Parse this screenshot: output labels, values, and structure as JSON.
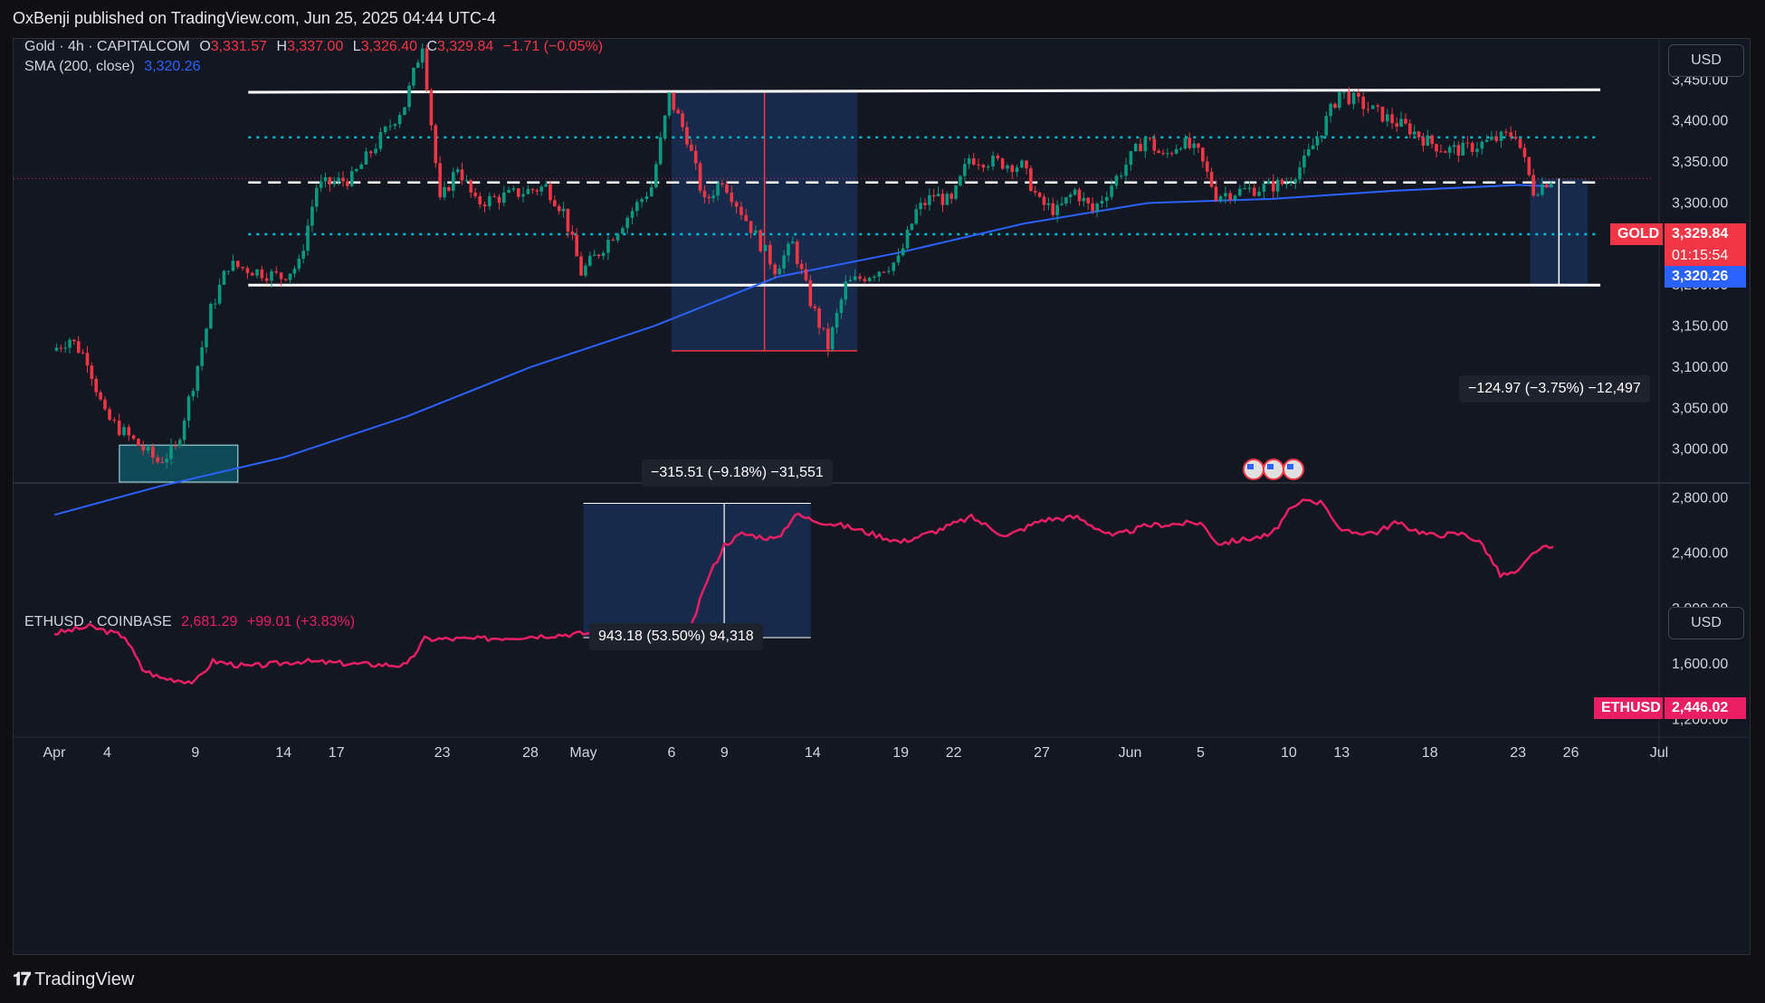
{
  "publisher": "OxBenji published on TradingView.com, Jun 25, 2025 04:44 UTC-4",
  "footer": {
    "brand": "TradingView"
  },
  "colors": {
    "up": "#089981",
    "down": "#f23645",
    "sma": "#2962ff",
    "eth": "#e91e63",
    "cyan": "#00bcd4",
    "box": "#1e3a6e"
  },
  "top_panel": {
    "legend": {
      "symbol": "Gold · 4h · CAPITALCOM",
      "o_label": "O",
      "o": "3,331.57",
      "h_label": "H",
      "h": "3,337.00",
      "l_label": "L",
      "l": "3,326.40",
      "c_label": "C",
      "c": "3,329.84",
      "change": "−1.71 (−0.05%)",
      "sma_label": "SMA (200, close)",
      "sma_value": "3,320.26"
    },
    "currency": "USD",
    "price_tag": {
      "name": "GOLD",
      "price": "3,329.84",
      "countdown": "01:15:54",
      "sma": "3,320.26"
    },
    "measure_1": "−315.51 (−9.18%) −31,551",
    "measure_2": "−124.97 (−3.75%) −12,497"
  },
  "bottom_panel": {
    "legend": {
      "symbol": "ETHUSD · COINBASE",
      "price": "2,681.29",
      "change": "+99.01 (+3.83%)"
    },
    "currency": "USD",
    "price_tag": {
      "name": "ETHUSD",
      "price": "2,446.02"
    },
    "measure": "943.18 (53.50%) 94,318"
  },
  "chart_data": [
    {
      "type": "candlestick",
      "symbol": "Gold",
      "timeframe": "4h",
      "y_ticks": [
        "3,000.00",
        "3,050.00",
        "3,100.00",
        "3,150.00",
        "3,200.00",
        "3,250.00",
        "3,300.00",
        "3,350.00",
        "3,400.00",
        "3,450.00"
      ],
      "ylim": [
        2960,
        3500
      ],
      "x_ticks": [
        "Apr",
        "4",
        "9",
        "14",
        "17",
        "23",
        "28",
        "May",
        "6",
        "9",
        "14",
        "19",
        "22",
        "27",
        "Jun",
        "5",
        "10",
        "13",
        "18",
        "23",
        "26",
        "Jul"
      ],
      "x_tick_dates": [
        "2025-04-01",
        "2025-04-04",
        "2025-04-09",
        "2025-04-14",
        "2025-04-17",
        "2025-04-23",
        "2025-04-28",
        "2025-05-01",
        "2025-05-06",
        "2025-05-09",
        "2025-05-14",
        "2025-05-19",
        "2025-05-22",
        "2025-05-27",
        "2025-06-01",
        "2025-06-05",
        "2025-06-10",
        "2025-06-13",
        "2025-06-18",
        "2025-06-23",
        "2025-06-26",
        "2025-07-01"
      ],
      "close_path": [
        [
          "2025-04-01",
          3120
        ],
        [
          "2025-04-02",
          3135
        ],
        [
          "2025-04-03",
          3110
        ],
        [
          "2025-04-04",
          3040
        ],
        [
          "2025-04-07",
          2985
        ],
        [
          "2025-04-08",
          3000
        ],
        [
          "2025-04-09",
          3080
        ],
        [
          "2025-04-10",
          3170
        ],
        [
          "2025-04-11",
          3225
        ],
        [
          "2025-04-14",
          3210
        ],
        [
          "2025-04-15",
          3225
        ],
        [
          "2025-04-16",
          3320
        ],
        [
          "2025-04-17",
          3325
        ],
        [
          "2025-04-18",
          3330
        ],
        [
          "2025-04-21",
          3420
        ],
        [
          "2025-04-22",
          3495
        ],
        [
          "2025-04-23",
          3300
        ],
        [
          "2025-04-24",
          3345
        ],
        [
          "2025-04-25",
          3300
        ],
        [
          "2025-04-28",
          3315
        ],
        [
          "2025-04-29",
          3320
        ],
        [
          "2025-04-30",
          3290
        ],
        [
          "2025-05-01",
          3215
        ],
        [
          "2025-05-02",
          3240
        ],
        [
          "2025-05-05",
          3320
        ],
        [
          "2025-05-06",
          3430
        ],
        [
          "2025-05-07",
          3380
        ],
        [
          "2025-05-08",
          3300
        ],
        [
          "2025-05-09",
          3330
        ],
        [
          "2025-05-12",
          3220
        ],
        [
          "2025-05-13",
          3250
        ],
        [
          "2025-05-14",
          3180
        ],
        [
          "2025-05-15",
          3125
        ],
        [
          "2025-05-16",
          3200
        ],
        [
          "2025-05-19",
          3230
        ],
        [
          "2025-05-20",
          3290
        ],
        [
          "2025-05-21",
          3310
        ],
        [
          "2025-05-22",
          3300
        ],
        [
          "2025-05-23",
          3355
        ],
        [
          "2025-05-26",
          3345
        ],
        [
          "2025-05-27",
          3300
        ],
        [
          "2025-05-28",
          3290
        ],
        [
          "2025-05-29",
          3315
        ],
        [
          "2025-05-30",
          3290
        ],
        [
          "2025-06-02",
          3380
        ],
        [
          "2025-06-03",
          3355
        ],
        [
          "2025-06-04",
          3375
        ],
        [
          "2025-06-05",
          3360
        ],
        [
          "2025-06-06",
          3310
        ],
        [
          "2025-06-09",
          3320
        ],
        [
          "2025-06-10",
          3325
        ],
        [
          "2025-06-11",
          3350
        ],
        [
          "2025-06-12",
          3390
        ],
        [
          "2025-06-13",
          3435
        ],
        [
          "2025-06-16",
          3400
        ],
        [
          "2025-06-17",
          3390
        ],
        [
          "2025-06-18",
          3375
        ],
        [
          "2025-06-19",
          3365
        ],
        [
          "2025-06-20",
          3365
        ],
        [
          "2025-06-23",
          3385
        ],
        [
          "2025-06-24",
          3315
        ],
        [
          "2025-06-25",
          3329.84
        ]
      ],
      "sma_200": [
        [
          "2025-04-01",
          2920
        ],
        [
          "2025-04-07",
          2955
        ],
        [
          "2025-04-14",
          2990
        ],
        [
          "2025-04-21",
          3040
        ],
        [
          "2025-04-28",
          3100
        ],
        [
          "2025-05-05",
          3150
        ],
        [
          "2025-05-12",
          3210
        ],
        [
          "2025-05-19",
          3240
        ],
        [
          "2025-05-26",
          3275
        ],
        [
          "2025-06-02",
          3300
        ],
        [
          "2025-06-09",
          3305
        ],
        [
          "2025-06-16",
          3315
        ],
        [
          "2025-06-23",
          3322
        ],
        [
          "2025-06-25",
          3320.26
        ]
      ],
      "horizontal_levels": {
        "resistance": 3435,
        "upper_mid": 3380,
        "mid": 3325,
        "lower_mid": 3262,
        "support": 3200
      }
    },
    {
      "type": "line",
      "symbol": "ETHUSD",
      "y_ticks": [
        "1,200.00",
        "1,600.00",
        "2,000.00",
        "2,400.00",
        "2,800.00"
      ],
      "ylim": [
        1150,
        2900
      ],
      "points": [
        [
          "2025-04-01",
          1820
        ],
        [
          "2025-04-03",
          1870
        ],
        [
          "2025-04-05",
          1800
        ],
        [
          "2025-04-06",
          1560
        ],
        [
          "2025-04-07",
          1500
        ],
        [
          "2025-04-09",
          1470
        ],
        [
          "2025-04-10",
          1620
        ],
        [
          "2025-04-12",
          1580
        ],
        [
          "2025-04-15",
          1620
        ],
        [
          "2025-04-18",
          1600
        ],
        [
          "2025-04-21",
          1590
        ],
        [
          "2025-04-22",
          1780
        ],
        [
          "2025-04-25",
          1780
        ],
        [
          "2025-04-28",
          1800
        ],
        [
          "2025-05-01",
          1820
        ],
        [
          "2025-05-03",
          1830
        ],
        [
          "2025-05-05",
          1810
        ],
        [
          "2025-05-06",
          1790
        ],
        [
          "2025-05-07",
          1820
        ],
        [
          "2025-05-08",
          2200
        ],
        [
          "2025-05-09",
          2460
        ],
        [
          "2025-05-10",
          2540
        ],
        [
          "2025-05-12",
          2500
        ],
        [
          "2025-05-13",
          2680
        ],
        [
          "2025-05-14",
          2640
        ],
        [
          "2025-05-16",
          2590
        ],
        [
          "2025-05-19",
          2480
        ],
        [
          "2025-05-21",
          2560
        ],
        [
          "2025-05-23",
          2660
        ],
        [
          "2025-05-25",
          2520
        ],
        [
          "2025-05-27",
          2640
        ],
        [
          "2025-05-29",
          2660
        ],
        [
          "2025-05-31",
          2520
        ],
        [
          "2025-06-02",
          2600
        ],
        [
          "2025-06-05",
          2620
        ],
        [
          "2025-06-06",
          2470
        ],
        [
          "2025-06-09",
          2530
        ],
        [
          "2025-06-10",
          2700
        ],
        [
          "2025-06-11",
          2790
        ],
        [
          "2025-06-12",
          2760
        ],
        [
          "2025-06-13",
          2550
        ],
        [
          "2025-06-15",
          2550
        ],
        [
          "2025-06-16",
          2620
        ],
        [
          "2025-06-18",
          2530
        ],
        [
          "2025-06-20",
          2540
        ],
        [
          "2025-06-21",
          2460
        ],
        [
          "2025-06-22",
          2240
        ],
        [
          "2025-06-23",
          2260
        ],
        [
          "2025-06-24",
          2420
        ],
        [
          "2025-06-25",
          2446.02
        ]
      ]
    }
  ]
}
